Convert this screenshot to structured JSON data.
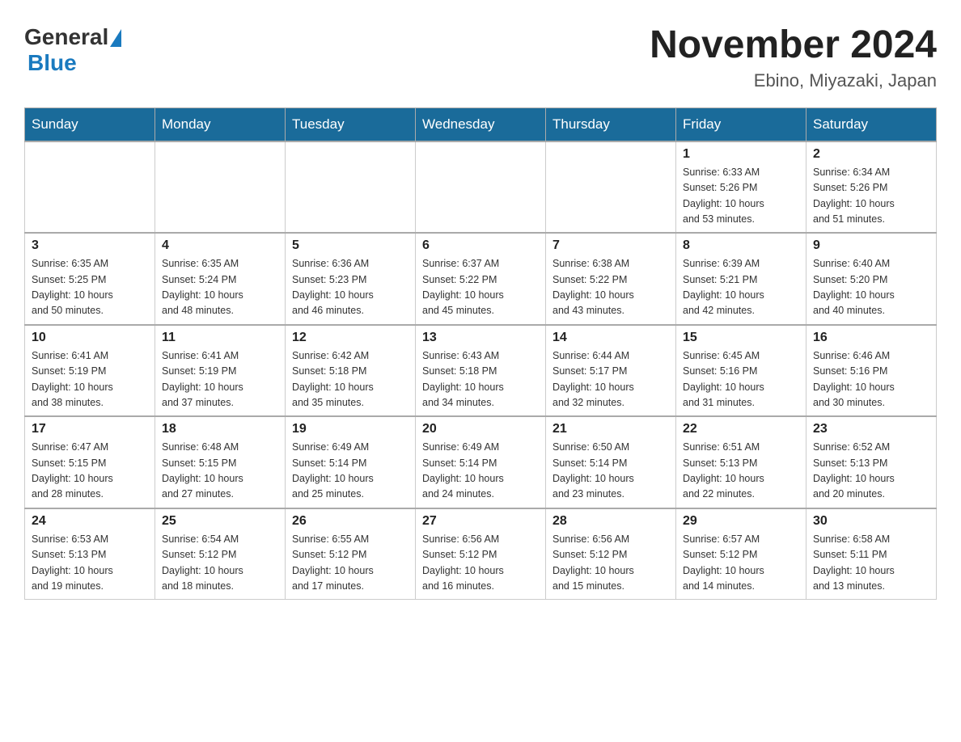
{
  "header": {
    "logo_general": "General",
    "logo_blue": "Blue",
    "month_title": "November 2024",
    "location": "Ebino, Miyazaki, Japan"
  },
  "days_of_week": [
    "Sunday",
    "Monday",
    "Tuesday",
    "Wednesday",
    "Thursday",
    "Friday",
    "Saturday"
  ],
  "weeks": [
    [
      {
        "day": "",
        "info": ""
      },
      {
        "day": "",
        "info": ""
      },
      {
        "day": "",
        "info": ""
      },
      {
        "day": "",
        "info": ""
      },
      {
        "day": "",
        "info": ""
      },
      {
        "day": "1",
        "info": "Sunrise: 6:33 AM\nSunset: 5:26 PM\nDaylight: 10 hours\nand 53 minutes."
      },
      {
        "day": "2",
        "info": "Sunrise: 6:34 AM\nSunset: 5:26 PM\nDaylight: 10 hours\nand 51 minutes."
      }
    ],
    [
      {
        "day": "3",
        "info": "Sunrise: 6:35 AM\nSunset: 5:25 PM\nDaylight: 10 hours\nand 50 minutes."
      },
      {
        "day": "4",
        "info": "Sunrise: 6:35 AM\nSunset: 5:24 PM\nDaylight: 10 hours\nand 48 minutes."
      },
      {
        "day": "5",
        "info": "Sunrise: 6:36 AM\nSunset: 5:23 PM\nDaylight: 10 hours\nand 46 minutes."
      },
      {
        "day": "6",
        "info": "Sunrise: 6:37 AM\nSunset: 5:22 PM\nDaylight: 10 hours\nand 45 minutes."
      },
      {
        "day": "7",
        "info": "Sunrise: 6:38 AM\nSunset: 5:22 PM\nDaylight: 10 hours\nand 43 minutes."
      },
      {
        "day": "8",
        "info": "Sunrise: 6:39 AM\nSunset: 5:21 PM\nDaylight: 10 hours\nand 42 minutes."
      },
      {
        "day": "9",
        "info": "Sunrise: 6:40 AM\nSunset: 5:20 PM\nDaylight: 10 hours\nand 40 minutes."
      }
    ],
    [
      {
        "day": "10",
        "info": "Sunrise: 6:41 AM\nSunset: 5:19 PM\nDaylight: 10 hours\nand 38 minutes."
      },
      {
        "day": "11",
        "info": "Sunrise: 6:41 AM\nSunset: 5:19 PM\nDaylight: 10 hours\nand 37 minutes."
      },
      {
        "day": "12",
        "info": "Sunrise: 6:42 AM\nSunset: 5:18 PM\nDaylight: 10 hours\nand 35 minutes."
      },
      {
        "day": "13",
        "info": "Sunrise: 6:43 AM\nSunset: 5:18 PM\nDaylight: 10 hours\nand 34 minutes."
      },
      {
        "day": "14",
        "info": "Sunrise: 6:44 AM\nSunset: 5:17 PM\nDaylight: 10 hours\nand 32 minutes."
      },
      {
        "day": "15",
        "info": "Sunrise: 6:45 AM\nSunset: 5:16 PM\nDaylight: 10 hours\nand 31 minutes."
      },
      {
        "day": "16",
        "info": "Sunrise: 6:46 AM\nSunset: 5:16 PM\nDaylight: 10 hours\nand 30 minutes."
      }
    ],
    [
      {
        "day": "17",
        "info": "Sunrise: 6:47 AM\nSunset: 5:15 PM\nDaylight: 10 hours\nand 28 minutes."
      },
      {
        "day": "18",
        "info": "Sunrise: 6:48 AM\nSunset: 5:15 PM\nDaylight: 10 hours\nand 27 minutes."
      },
      {
        "day": "19",
        "info": "Sunrise: 6:49 AM\nSunset: 5:14 PM\nDaylight: 10 hours\nand 25 minutes."
      },
      {
        "day": "20",
        "info": "Sunrise: 6:49 AM\nSunset: 5:14 PM\nDaylight: 10 hours\nand 24 minutes."
      },
      {
        "day": "21",
        "info": "Sunrise: 6:50 AM\nSunset: 5:14 PM\nDaylight: 10 hours\nand 23 minutes."
      },
      {
        "day": "22",
        "info": "Sunrise: 6:51 AM\nSunset: 5:13 PM\nDaylight: 10 hours\nand 22 minutes."
      },
      {
        "day": "23",
        "info": "Sunrise: 6:52 AM\nSunset: 5:13 PM\nDaylight: 10 hours\nand 20 minutes."
      }
    ],
    [
      {
        "day": "24",
        "info": "Sunrise: 6:53 AM\nSunset: 5:13 PM\nDaylight: 10 hours\nand 19 minutes."
      },
      {
        "day": "25",
        "info": "Sunrise: 6:54 AM\nSunset: 5:12 PM\nDaylight: 10 hours\nand 18 minutes."
      },
      {
        "day": "26",
        "info": "Sunrise: 6:55 AM\nSunset: 5:12 PM\nDaylight: 10 hours\nand 17 minutes."
      },
      {
        "day": "27",
        "info": "Sunrise: 6:56 AM\nSunset: 5:12 PM\nDaylight: 10 hours\nand 16 minutes."
      },
      {
        "day": "28",
        "info": "Sunrise: 6:56 AM\nSunset: 5:12 PM\nDaylight: 10 hours\nand 15 minutes."
      },
      {
        "day": "29",
        "info": "Sunrise: 6:57 AM\nSunset: 5:12 PM\nDaylight: 10 hours\nand 14 minutes."
      },
      {
        "day": "30",
        "info": "Sunrise: 6:58 AM\nSunset: 5:11 PM\nDaylight: 10 hours\nand 13 minutes."
      }
    ]
  ]
}
